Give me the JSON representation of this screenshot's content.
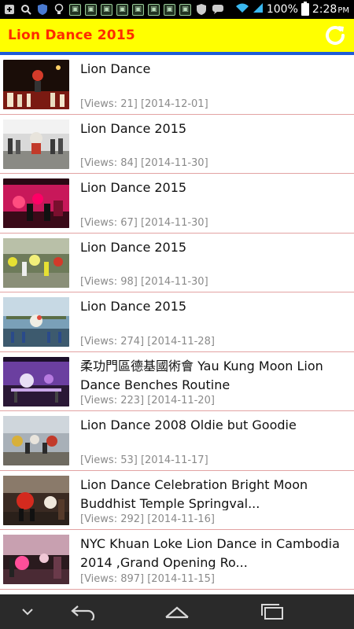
{
  "status_bar": {
    "battery": "100%",
    "time": "2:28",
    "ampm": "PM",
    "icons": [
      "plus-box-icon",
      "search-icon",
      "shield-icon",
      "bulb-icon",
      "notification-icon",
      "notification-icon",
      "notification-icon",
      "notification-icon",
      "notification-icon",
      "notification-icon",
      "notification-icon",
      "notification-icon",
      "shield-outline-icon",
      "chat-icon",
      "wifi-icon",
      "signal-icon",
      "battery-icon"
    ]
  },
  "app_bar": {
    "title": "Lion Dance 2015",
    "refresh_icon": "refresh-icon",
    "colors": {
      "background": "#ffff00",
      "title": "#ff2a00",
      "rule": "#1e5bd8"
    }
  },
  "videos": [
    {
      "title": "Lion Dance",
      "meta": "[Views: 21] [2014-12-01]"
    },
    {
      "title": "Lion Dance 2015",
      "meta": "[Views: 84] [2014-11-30]"
    },
    {
      "title": "Lion Dance 2015",
      "meta": "[Views: 67] [2014-11-30]"
    },
    {
      "title": "Lion Dance 2015",
      "meta": "[Views: 98] [2014-11-30]"
    },
    {
      "title": "Lion Dance 2015",
      "meta": "[Views: 274] [2014-11-28]"
    },
    {
      "title": "柔功門區德基國術會 Yau Kung Moon Lion Dance Benches Routine",
      "meta": "[Views: 223] [2014-11-20]"
    },
    {
      "title": "Lion Dance 2008 Oldie but Goodie",
      "meta": "[Views: 53] [2014-11-17]"
    },
    {
      "title": "Lion Dance Celebration Bright Moon Buddhist Temple Springval...",
      "meta": "[Views: 292] [2014-11-16]"
    },
    {
      "title": "NYC Khuan Loke Lion Dance in Cambodia 2014 ,Grand Opening Ro...",
      "meta": "[Views: 897] [2014-11-15]"
    }
  ],
  "nav_bar": {
    "icons": [
      "chevron-down-icon",
      "back-icon",
      "home-icon",
      "recent-apps-icon"
    ]
  }
}
